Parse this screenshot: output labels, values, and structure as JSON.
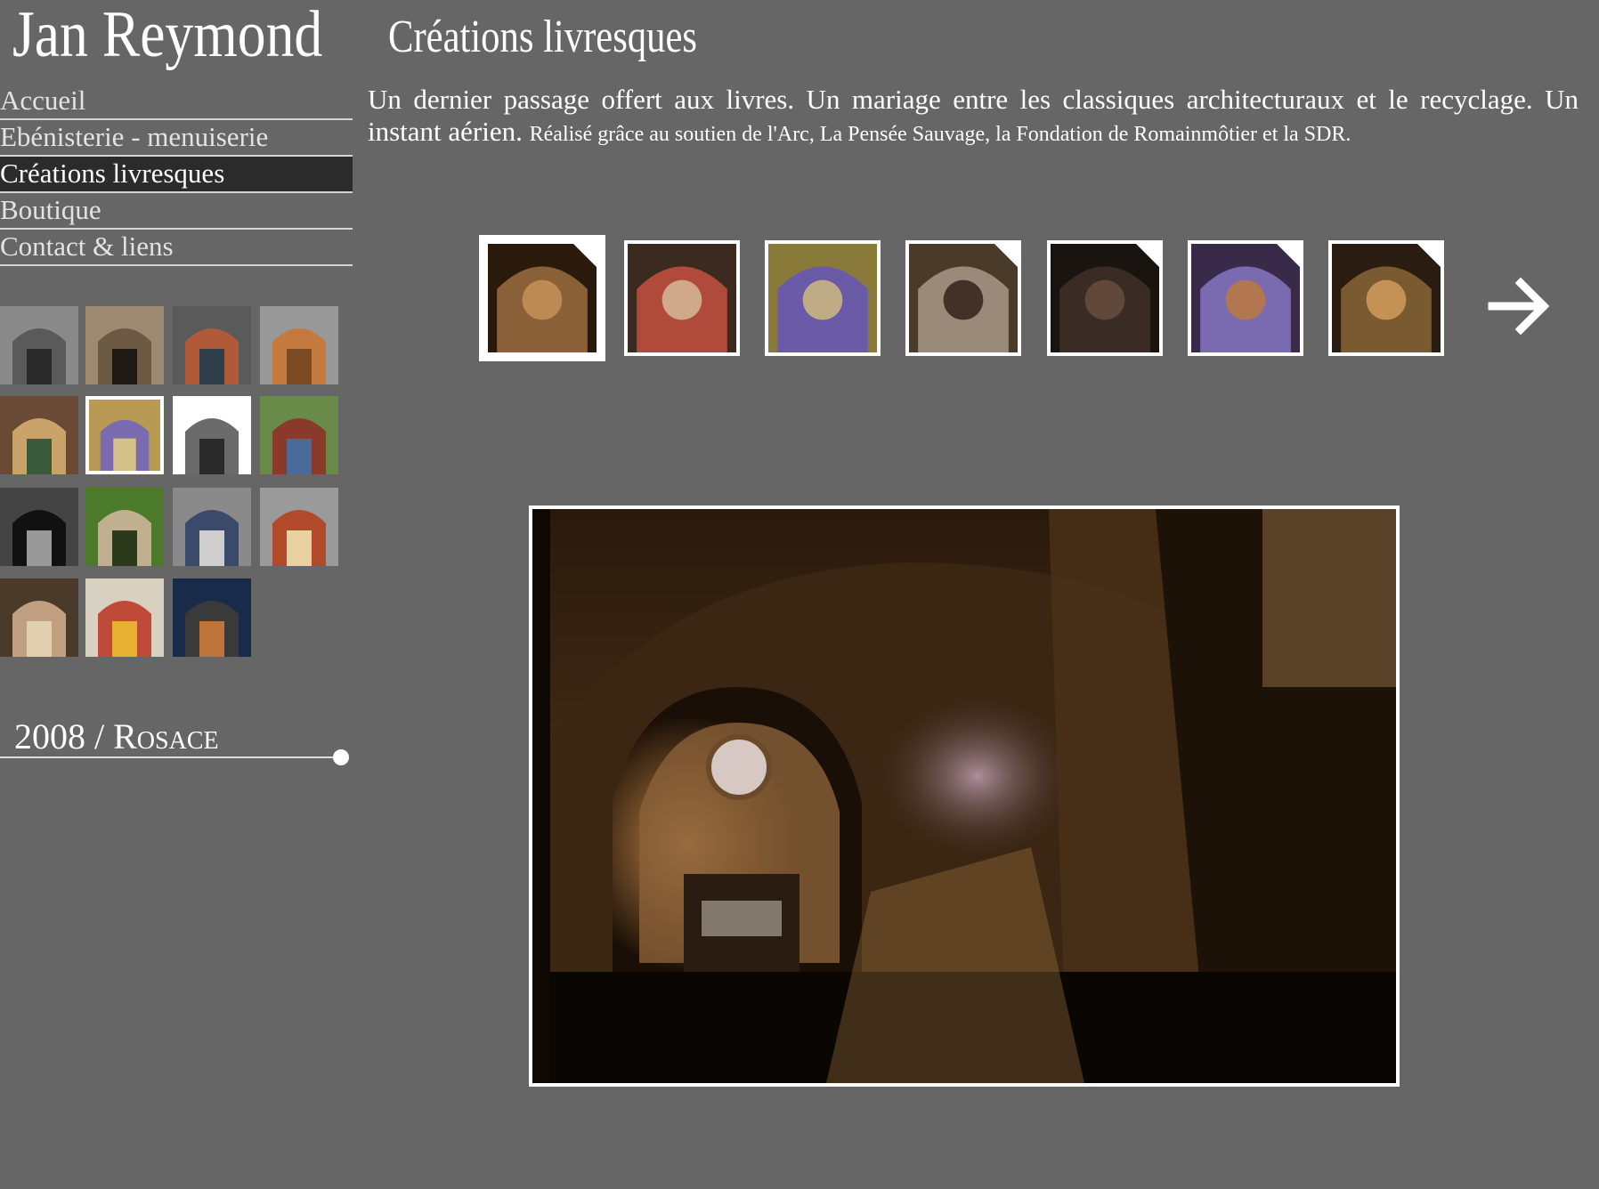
{
  "header": {
    "name": "Jan Reymond",
    "section": "Créations livresques"
  },
  "nav": {
    "items": [
      {
        "label": "Accueil",
        "active": false
      },
      {
        "label": "Ebénisterie - menuiserie",
        "active": false
      },
      {
        "label": "Créations livresques",
        "active": true
      },
      {
        "label": "Boutique",
        "active": false
      },
      {
        "label": "Contact & liens",
        "active": false
      }
    ]
  },
  "description": {
    "text": "Un dernier passage offert aux livres. Un mariage entre les classiques architecturaux et le recyclage. Un instant aérien.",
    "credits": "Réalisé grâce au soutien de l'Arc, La Pensée Sauvage, la Fondation de Romainmôtier et la SDR."
  },
  "project": {
    "year": "2008",
    "separator": "/",
    "name": "Rosace"
  },
  "project_grid": {
    "selected_index": 5,
    "thumbs": [
      {
        "name": "stone-window-thumb"
      },
      {
        "name": "twin-window-thumb"
      },
      {
        "name": "book-ceiling-thumb"
      },
      {
        "name": "book-bench-thumb"
      },
      {
        "name": "book-wall-thumb"
      },
      {
        "name": "rosace-thumb"
      },
      {
        "name": "book-tree-thumb"
      },
      {
        "name": "book-gate-thumb"
      },
      {
        "name": "book-star-thumb"
      },
      {
        "name": "book-sculpture-thumb"
      },
      {
        "name": "book-figures-thumb"
      },
      {
        "name": "book-column-thumb"
      },
      {
        "name": "book-face-thumb"
      },
      {
        "name": "book-chaise-thumb"
      },
      {
        "name": "night-house-thumb"
      }
    ]
  },
  "filmstrip": {
    "selected_index": 0,
    "next_icon": "right-arrow-icon",
    "thumbs": [
      {
        "name": "archway-night-photo",
        "folded": true
      },
      {
        "name": "book-pile-photo",
        "folded": false
      },
      {
        "name": "rosace-window-photo",
        "folded": false
      },
      {
        "name": "book-wall-arch-photo",
        "folded": true
      },
      {
        "name": "visitors-photo",
        "folded": true
      },
      {
        "name": "rosace-angle-photo",
        "folded": true
      },
      {
        "name": "tower-night-photo",
        "folded": true
      }
    ]
  },
  "main_image": {
    "name": "archway-night-photo"
  },
  "colors": {
    "background": "#666666",
    "active_nav": "#2b2b2b",
    "text": "#ffffff",
    "nav_text": "#e3e3e3"
  }
}
